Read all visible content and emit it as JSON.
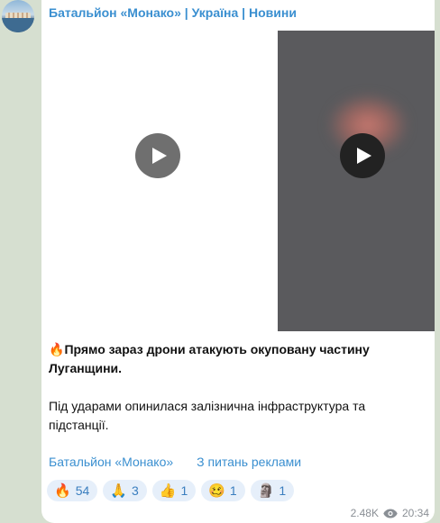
{
  "channel": {
    "name": "Батальйон «Монако» | Україна | Новини",
    "avatar_icon": "channel-avatar"
  },
  "media": [
    {
      "type": "video",
      "play_icon": "play-icon"
    },
    {
      "type": "video",
      "play_icon": "play-icon"
    }
  ],
  "post": {
    "emoji": "🔥",
    "headline": "Прямо зараз дрони атакують окуповану частину Луганщини.",
    "body": "Під ударами опинилася залізнична інфраструктура та підстанції."
  },
  "links": {
    "channel": "Батальйон «Монако»",
    "ads": "З питань реклами"
  },
  "reactions": [
    {
      "emoji": "🔥",
      "count": "54"
    },
    {
      "emoji": "🙏",
      "count": "3"
    },
    {
      "emoji": "👍",
      "count": "1"
    },
    {
      "emoji": "🥴",
      "count": "1"
    },
    {
      "emoji": "🗿",
      "count": "1"
    }
  ],
  "meta": {
    "views": "2.48K",
    "views_icon": "eye-icon",
    "time": "20:34"
  },
  "colors": {
    "link": "#3a8fd0",
    "reaction_bg": "#e6effa",
    "chat_bg": "#d6dfd0"
  }
}
